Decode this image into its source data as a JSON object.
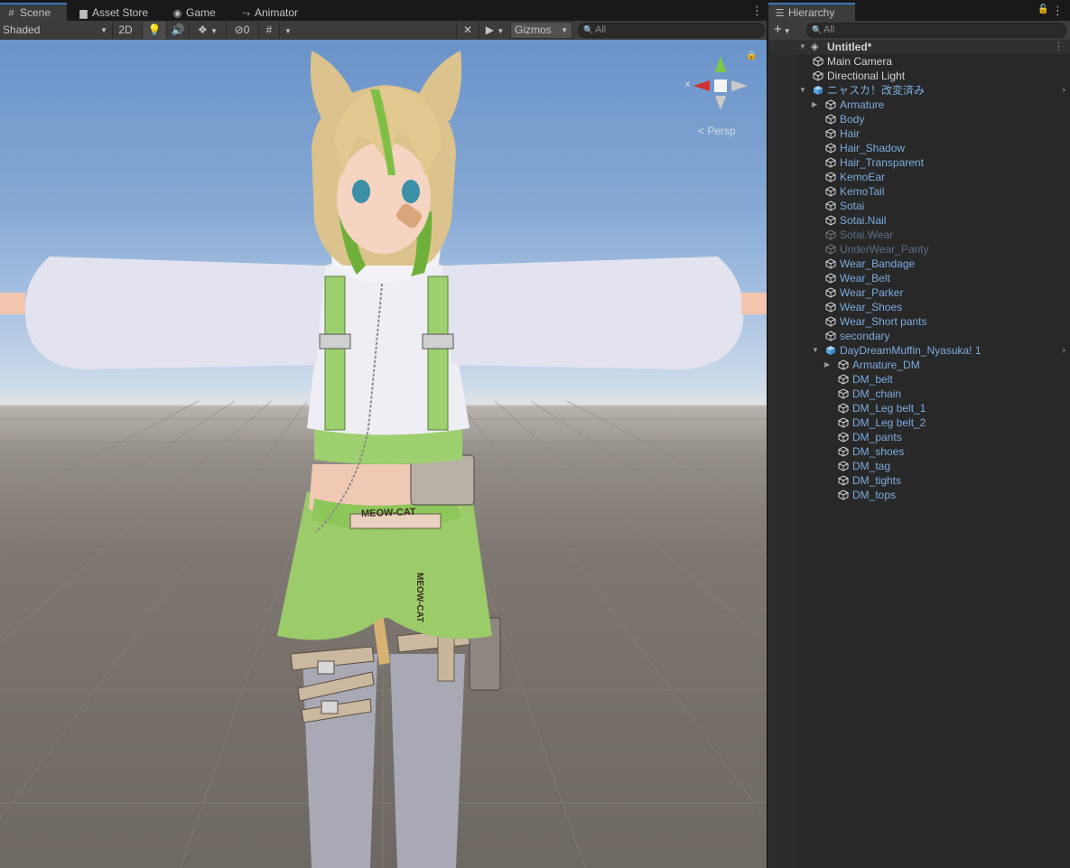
{
  "scene_window": {
    "tabs": [
      {
        "label": "Scene",
        "icon": "grid-icon",
        "active": true
      },
      {
        "label": "Asset Store",
        "icon": "bag-icon",
        "active": false
      },
      {
        "label": "Game",
        "icon": "gamepad-icon",
        "active": false
      },
      {
        "label": "Animator",
        "icon": "animator-icon",
        "active": false
      }
    ],
    "toolbar": {
      "draw_mode": "Shaded",
      "mode_2d": "2D",
      "hidden_count": "0",
      "gizmos": "Gizmos",
      "search_placeholder": "All"
    },
    "gizmo": {
      "x_axis": "x",
      "projection": "< Persp"
    },
    "scene_text": {
      "belt_text": "MEOW-CAT",
      "strap_text": "MEOW-CAT"
    }
  },
  "hierarchy": {
    "tab_label": "Hierarchy",
    "search_placeholder": "All",
    "scene_name": "Untitled*",
    "items": [
      {
        "label": "Main Camera",
        "depth": 1,
        "style": "plain",
        "fold": ""
      },
      {
        "label": "Directional Light",
        "depth": 1,
        "style": "plain",
        "fold": ""
      },
      {
        "label": "ニャスカ！改変済み",
        "depth": 1,
        "style": "prefab",
        "fold": "open",
        "prefab_root": true
      },
      {
        "label": "Armature",
        "depth": 2,
        "style": "prefab",
        "fold": "closed"
      },
      {
        "label": "Body",
        "depth": 2,
        "style": "prefab",
        "fold": ""
      },
      {
        "label": "Hair",
        "depth": 2,
        "style": "prefab",
        "fold": ""
      },
      {
        "label": "Hair_Shadow",
        "depth": 2,
        "style": "prefab",
        "fold": ""
      },
      {
        "label": "Hair_Transparent",
        "depth": 2,
        "style": "prefab",
        "fold": ""
      },
      {
        "label": "KemoEar",
        "depth": 2,
        "style": "prefab",
        "fold": ""
      },
      {
        "label": "KemoTail",
        "depth": 2,
        "style": "prefab",
        "fold": ""
      },
      {
        "label": "Sotai",
        "depth": 2,
        "style": "prefab",
        "fold": ""
      },
      {
        "label": "Sotai.Nail",
        "depth": 2,
        "style": "prefab",
        "fold": ""
      },
      {
        "label": "Sotai.Wear",
        "depth": 2,
        "style": "inactive",
        "fold": ""
      },
      {
        "label": "UnderWear_Panty",
        "depth": 2,
        "style": "inactive",
        "fold": ""
      },
      {
        "label": "Wear_Bandage",
        "depth": 2,
        "style": "prefab",
        "fold": ""
      },
      {
        "label": "Wear_Belt",
        "depth": 2,
        "style": "prefab",
        "fold": ""
      },
      {
        "label": "Wear_Parker",
        "depth": 2,
        "style": "prefab",
        "fold": ""
      },
      {
        "label": "Wear_Shoes",
        "depth": 2,
        "style": "prefab",
        "fold": ""
      },
      {
        "label": "Wear_Short pants",
        "depth": 2,
        "style": "prefab",
        "fold": ""
      },
      {
        "label": "secondary",
        "depth": 2,
        "style": "prefab",
        "fold": ""
      },
      {
        "label": "DayDreamMuffin_Nyasuka! 1",
        "depth": 2,
        "style": "prefab",
        "fold": "open",
        "prefab_root": true
      },
      {
        "label": "Armature_DM",
        "depth": 3,
        "style": "prefab",
        "fold": "closed"
      },
      {
        "label": "DM_belt",
        "depth": 3,
        "style": "prefab",
        "fold": ""
      },
      {
        "label": "DM_chain",
        "depth": 3,
        "style": "prefab",
        "fold": ""
      },
      {
        "label": "DM_Leg belt_1",
        "depth": 3,
        "style": "prefab",
        "fold": ""
      },
      {
        "label": "DM_Leg belt_2",
        "depth": 3,
        "style": "prefab",
        "fold": ""
      },
      {
        "label": "DM_pants",
        "depth": 3,
        "style": "prefab",
        "fold": ""
      },
      {
        "label": "DM_shoes",
        "depth": 3,
        "style": "prefab",
        "fold": ""
      },
      {
        "label": "DM_tag",
        "depth": 3,
        "style": "prefab",
        "fold": ""
      },
      {
        "label": "DM_tights",
        "depth": 3,
        "style": "prefab",
        "fold": ""
      },
      {
        "label": "DM_tops",
        "depth": 3,
        "style": "prefab",
        "fold": ""
      }
    ]
  },
  "colors": {
    "accent": "#3a79bb",
    "prefab_text": "#7cacdf",
    "inactive_text": "#5e6f85",
    "panel_bg": "#282828",
    "toolbar_bg": "#3c3c3c"
  }
}
